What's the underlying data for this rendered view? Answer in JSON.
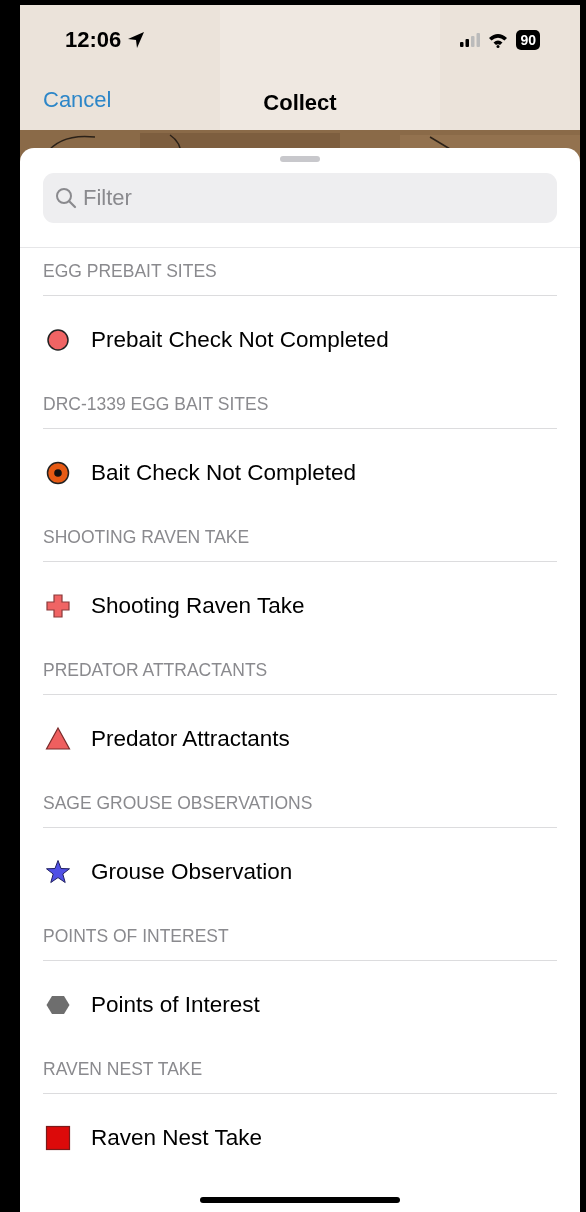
{
  "status_bar": {
    "time": "12:06",
    "battery": "90"
  },
  "nav": {
    "cancel": "Cancel",
    "title": "Collect"
  },
  "filter": {
    "placeholder": "Filter"
  },
  "sections": [
    {
      "header": "EGG PREBAIT SITES",
      "item": {
        "label": "Prebait Check Not Completed",
        "kind": "circle",
        "color": "#f06464"
      }
    },
    {
      "header": "DRC-1339 EGG BAIT SITES",
      "item": {
        "label": "Bait Check Not Completed",
        "kind": "target",
        "color": "#e65a14"
      }
    },
    {
      "header": "SHOOTING RAVEN TAKE",
      "item": {
        "label": "Shooting Raven Take",
        "kind": "cross",
        "color": "#f06464"
      }
    },
    {
      "header": "PREDATOR ATTRACTANTS",
      "item": {
        "label": "Predator Attractants",
        "kind": "triangle",
        "color": "#ef5f5f"
      }
    },
    {
      "header": "SAGE GROUSE OBSERVATIONS",
      "item": {
        "label": "Grouse Observation",
        "kind": "star",
        "color": "#5050e6"
      }
    },
    {
      "header": "POINTS OF INTEREST",
      "item": {
        "label": "Points of Interest",
        "kind": "hexagon",
        "color": "#6e6e6e"
      }
    },
    {
      "header": "RAVEN NEST TAKE",
      "item": {
        "label": "Raven Nest Take",
        "kind": "square",
        "color": "#dc0a0a"
      }
    }
  ]
}
